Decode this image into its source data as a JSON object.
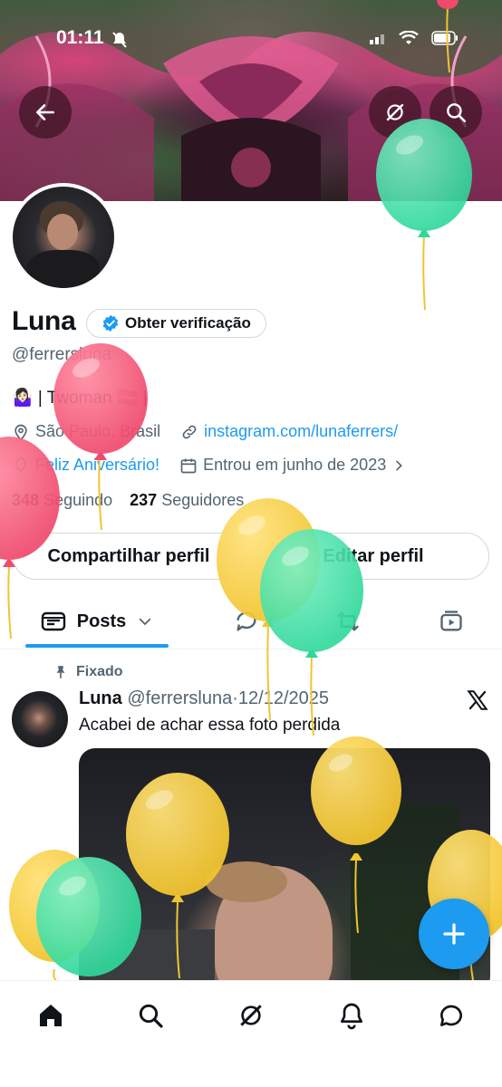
{
  "status_bar": {
    "time": "01:11"
  },
  "profile": {
    "name": "Luna",
    "verify_label": "Obter verificação",
    "handle": "@ferrersluna",
    "bio": "🤷🏻‍♀️ | Twoman 🏳️‍⚧️ |",
    "location": "São Paulo, Brasil",
    "link": "instagram.com/lunaferrers/",
    "birthday": "Feliz Aniversário!",
    "joined": "Entrou em junho de 2023",
    "following_count": "348",
    "following_label": "Seguindo",
    "followers_count": "237",
    "followers_label": "Seguidores"
  },
  "actions": {
    "share_label": "Compartilhar perfil",
    "edit_label": "Editar perfil"
  },
  "tabs": {
    "posts_label": "Posts"
  },
  "post": {
    "pinned_label": "Fixado",
    "author": "Luna",
    "handle": "@ferrersluna",
    "separator": "·",
    "date": "12/12/2025",
    "text": "Acabei de achar essa foto perdida"
  },
  "colors": {
    "accent": "#1d9bf0",
    "balloon_red": "#ef4a6d",
    "balloon_green": "#2fd89a",
    "balloon_yellow": "#f2c42f"
  },
  "icons": [
    "back-arrow-icon",
    "grok-icon",
    "search-icon",
    "verified-badge-icon",
    "location-icon",
    "link-icon",
    "balloon-icon",
    "calendar-icon",
    "chevron-right-icon",
    "chevron-down-icon",
    "reply-icon",
    "repost-icon",
    "video-icon",
    "pin-icon",
    "x-logo-icon",
    "plus-icon",
    "home-icon",
    "bell-icon",
    "message-icon"
  ]
}
